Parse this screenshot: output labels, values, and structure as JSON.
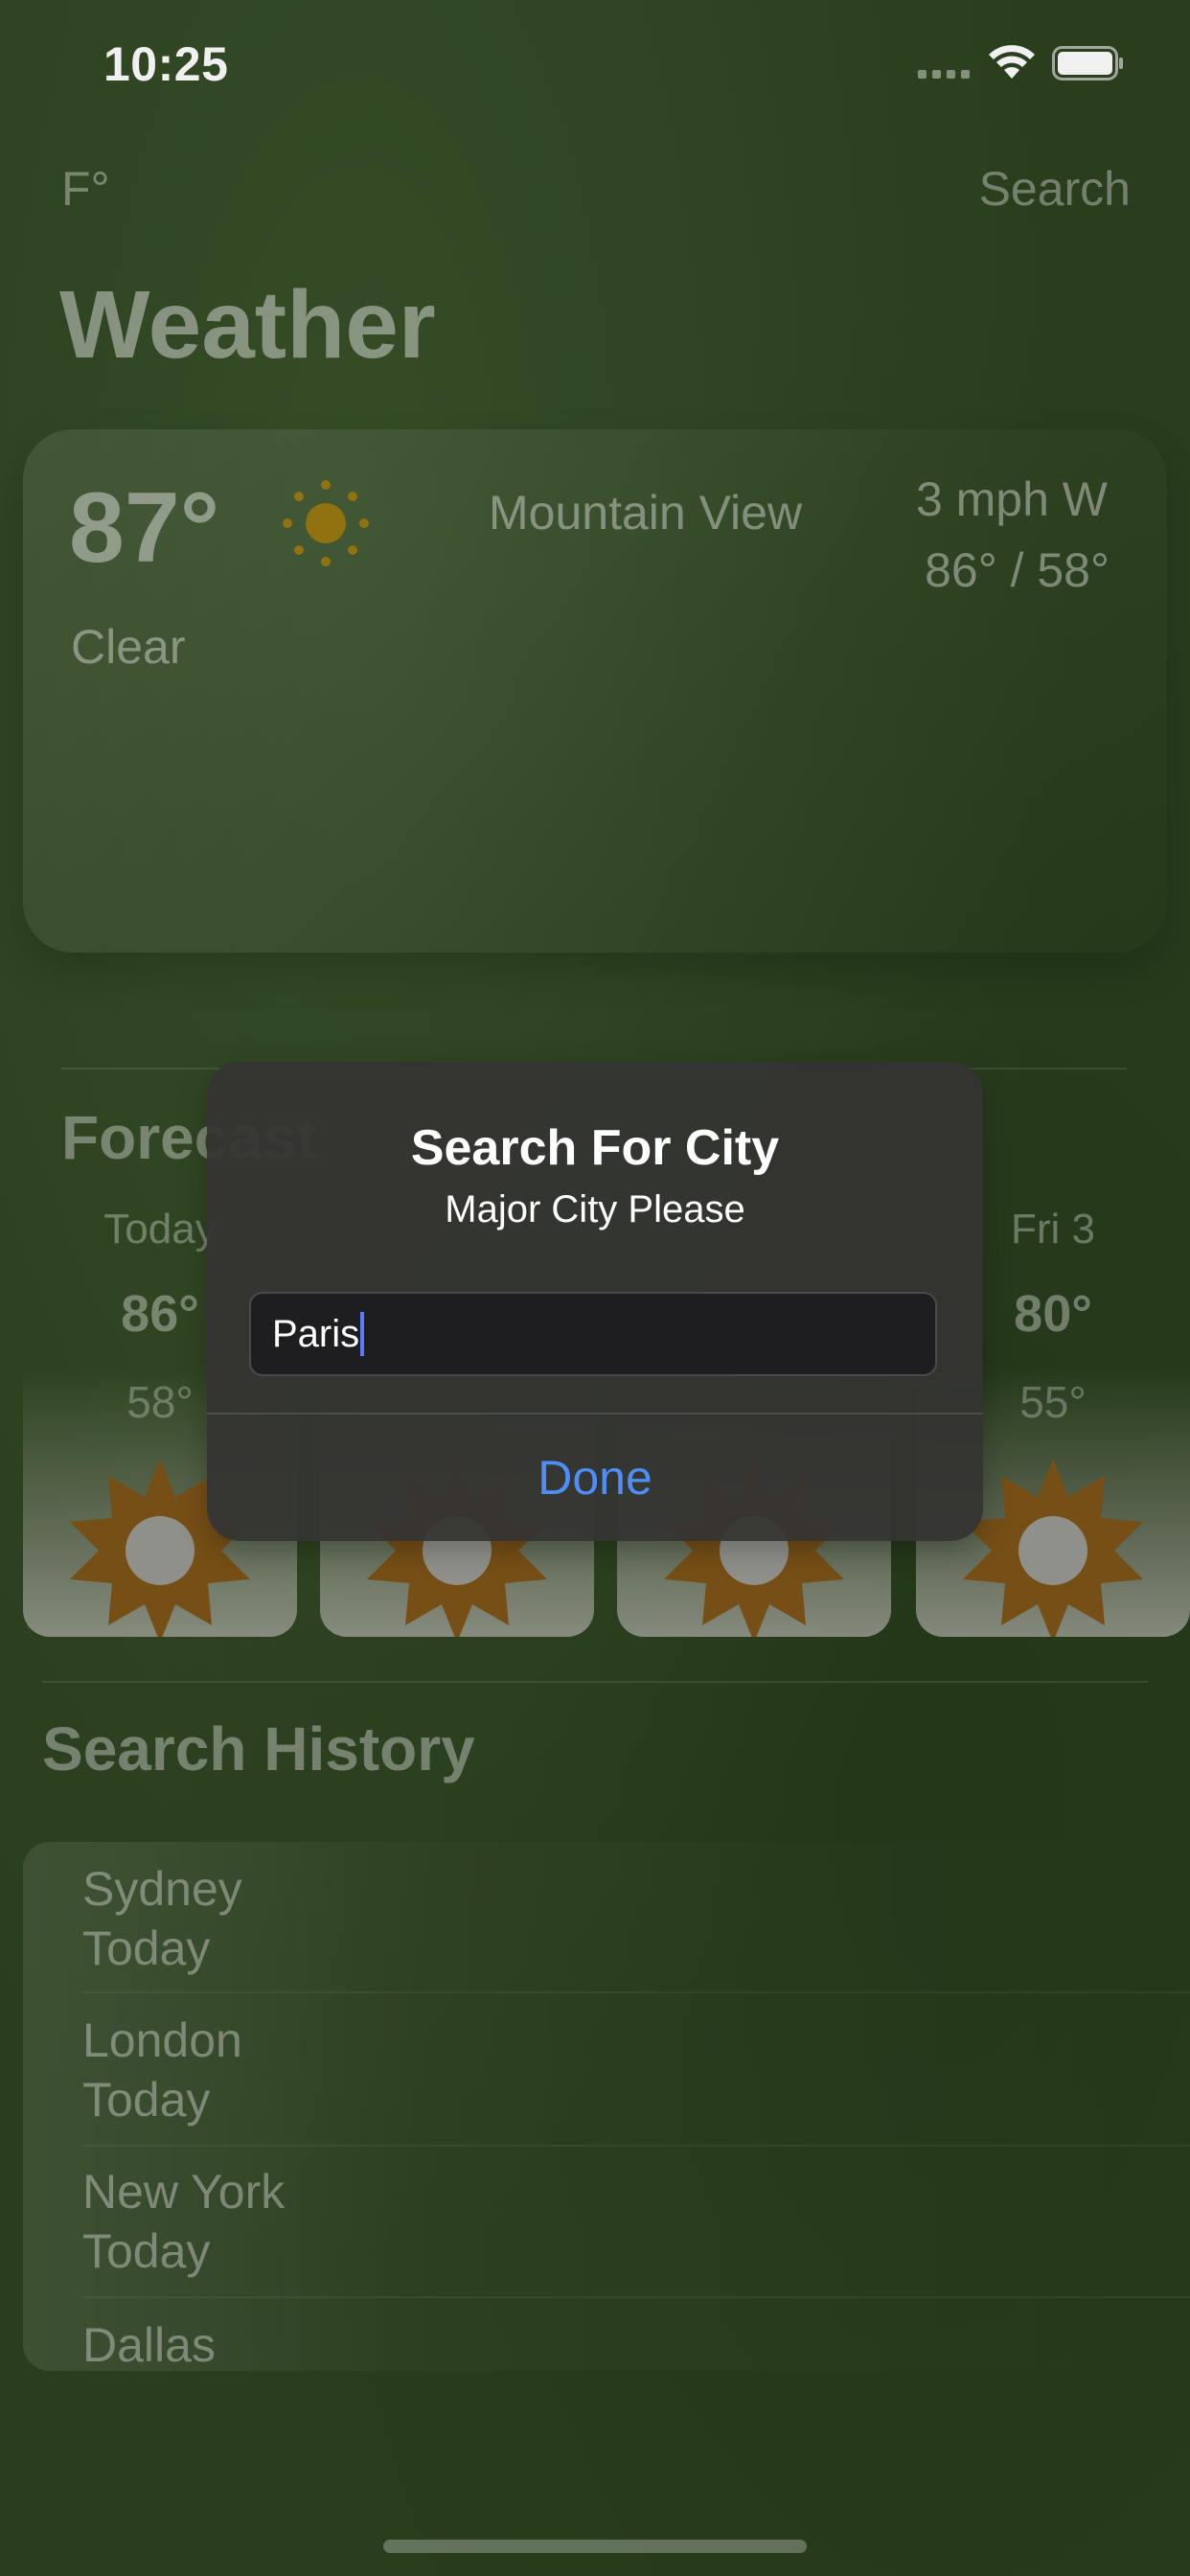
{
  "status": {
    "time": "10:25"
  },
  "nav": {
    "unit_label": "F°",
    "search_label": "Search",
    "title": "Weather"
  },
  "current": {
    "temp": "87°",
    "condition": "Clear",
    "city": "Mountain View",
    "wind": "3 mph W",
    "hilo": "86° / 58°",
    "icon": "sun-icon"
  },
  "forecast": {
    "title": "Forecast",
    "days": [
      {
        "label": "Today",
        "high": "86°",
        "low": "58°",
        "icon": "sun-icon"
      },
      {
        "label": "",
        "high": "",
        "low": "",
        "icon": "sun-icon"
      },
      {
        "label": "",
        "high": "",
        "low": "",
        "icon": "sun-icon"
      },
      {
        "label": "Fri 3",
        "high": "80°",
        "low": "55°",
        "icon": "sun-icon"
      }
    ]
  },
  "history": {
    "title": "Search History",
    "items": [
      {
        "city": "Sydney",
        "when": "Today"
      },
      {
        "city": "London",
        "when": "Today"
      },
      {
        "city": "New York",
        "when": "Today"
      },
      {
        "city": "Dallas",
        "when": ""
      }
    ]
  },
  "alert": {
    "title": "Search For City",
    "message": "Major City Please",
    "input_value": "Paris",
    "done_label": "Done"
  },
  "colors": {
    "background": "#2d4220",
    "accent": "#4d8ef7",
    "sun_current": "#b8900f",
    "sun_forecast": "#8a5a1a"
  }
}
